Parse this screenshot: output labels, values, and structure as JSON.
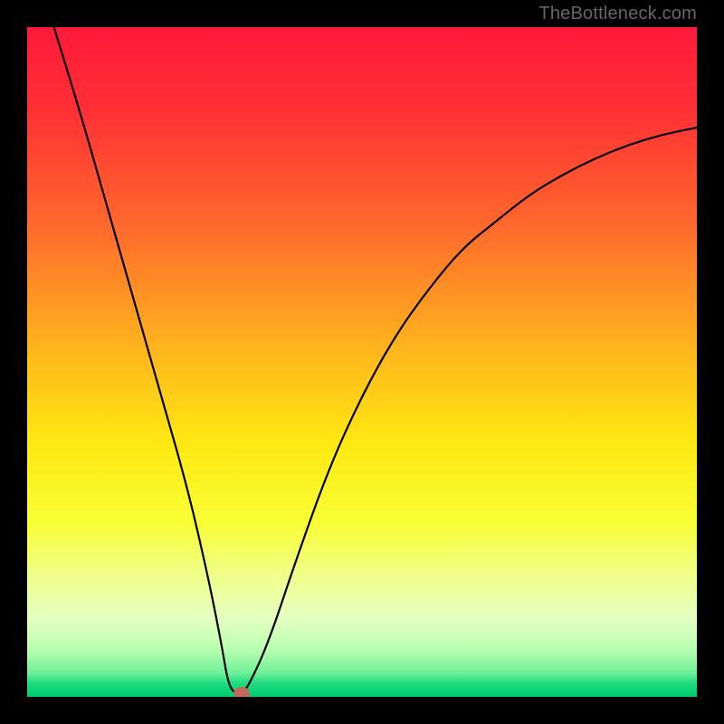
{
  "watermark": "TheBottleneck.com",
  "chart_data": {
    "type": "line",
    "title": "",
    "xlabel": "",
    "ylabel": "",
    "xlim": [
      0,
      100
    ],
    "ylim": [
      0,
      100
    ],
    "annotations": [],
    "background_gradient_stops": [
      {
        "pct": 0,
        "color": "#ff1a3a"
      },
      {
        "pct": 12,
        "color": "#ff2f36"
      },
      {
        "pct": 30,
        "color": "#ff6a2c"
      },
      {
        "pct": 48,
        "color": "#ffb41d"
      },
      {
        "pct": 62,
        "color": "#ffe812"
      },
      {
        "pct": 74,
        "color": "#f8ff34"
      },
      {
        "pct": 82,
        "color": "#f0ff8a"
      },
      {
        "pct": 88,
        "color": "#e6ffc0"
      },
      {
        "pct": 93,
        "color": "#b8ffb0"
      },
      {
        "pct": 96.5,
        "color": "#6cf098"
      },
      {
        "pct": 98,
        "color": "#1edb80"
      },
      {
        "pct": 100,
        "color": "#00cc6e"
      }
    ],
    "series": [
      {
        "name": "bottleneck-curve",
        "points": [
          {
            "x": 4,
            "y": 100
          },
          {
            "x": 8,
            "y": 87
          },
          {
            "x": 12,
            "y": 73
          },
          {
            "x": 16,
            "y": 59
          },
          {
            "x": 20,
            "y": 45
          },
          {
            "x": 24,
            "y": 31
          },
          {
            "x": 27,
            "y": 18
          },
          {
            "x": 29,
            "y": 8
          },
          {
            "x": 30,
            "y": 2
          },
          {
            "x": 31,
            "y": 0.5
          },
          {
            "x": 32,
            "y": 0.5
          },
          {
            "x": 33,
            "y": 1.5
          },
          {
            "x": 36,
            "y": 8
          },
          {
            "x": 40,
            "y": 20
          },
          {
            "x": 45,
            "y": 34
          },
          {
            "x": 50,
            "y": 45
          },
          {
            "x": 55,
            "y": 54
          },
          {
            "x": 60,
            "y": 61
          },
          {
            "x": 65,
            "y": 67
          },
          {
            "x": 70,
            "y": 71
          },
          {
            "x": 75,
            "y": 75
          },
          {
            "x": 80,
            "y": 78
          },
          {
            "x": 85,
            "y": 80.5
          },
          {
            "x": 90,
            "y": 82.5
          },
          {
            "x": 95,
            "y": 84
          },
          {
            "x": 100,
            "y": 85
          }
        ]
      }
    ],
    "minimum_marker": {
      "x": 32,
      "y": 0.5,
      "color": "#c56a5b"
    }
  }
}
